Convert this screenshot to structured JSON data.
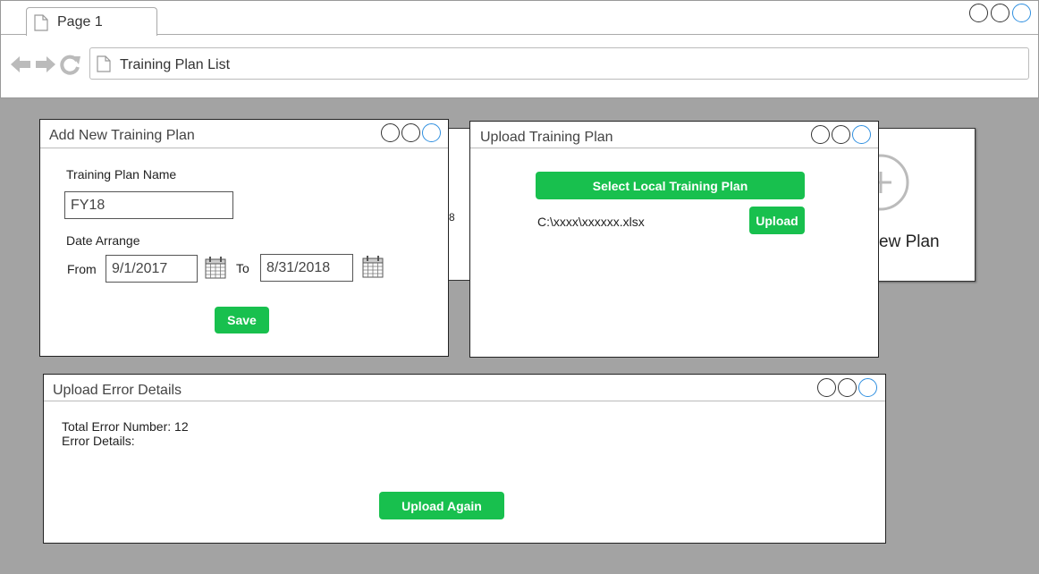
{
  "browser": {
    "tab_label": "Page 1",
    "address": "Training Plan List"
  },
  "background": {
    "card_label": "ew Plan",
    "partial_text": "8"
  },
  "add_plan_window": {
    "title": "Add New Training Plan",
    "name_label": "Training Plan Name",
    "name_value": "FY18",
    "date_label": "Date Arrange",
    "from_label": "From",
    "from_value": "9/1/2017",
    "to_label": "To",
    "to_value": "8/31/2018",
    "save_label": "Save"
  },
  "upload_window": {
    "title": "Upload Training Plan",
    "select_label": "Select Local Training Plan",
    "file_path": "C:\\xxxx\\xxxxxx.xlsx",
    "upload_label": "Upload"
  },
  "error_window": {
    "title": "Upload Error Details",
    "total_errors": "Total Error Number: 12",
    "details_label": "Error Details:",
    "upload_again_label": "Upload Again"
  },
  "colors": {
    "accent_green": "#18c04e",
    "background_gray": "#a3a3a3",
    "active_circle": "#2f8fe0"
  }
}
